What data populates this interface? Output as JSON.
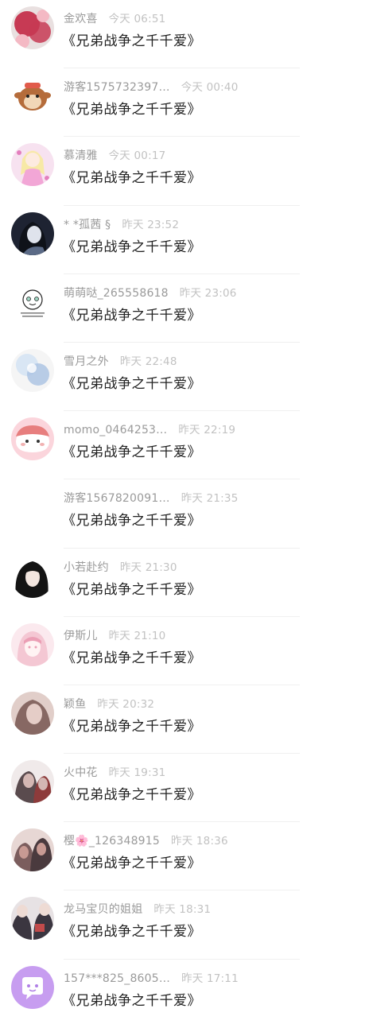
{
  "comments": [
    {
      "username": "金欢喜",
      "time": "今天 06:51",
      "content": "《兄弟战争之千千爱》",
      "avatar": "avatar-red-flowers",
      "avatar_colors": [
        "#c73a54",
        "#f4b9c4",
        "#e9e0e0"
      ]
    },
    {
      "username": "游客1575732397…",
      "time": "今天 00:40",
      "content": "《兄弟战争之千千爱》",
      "avatar": "avatar-cartoon-dog",
      "avatar_colors": [
        "#b56c3b",
        "#f2d7b8",
        "#ffffff"
      ]
    },
    {
      "username": "慕清雅",
      "time": "今天 00:17",
      "content": "《兄弟战争之千千爱》",
      "avatar": "avatar-pink-anime-girl",
      "avatar_colors": [
        "#f2a6d6",
        "#f7e2f0",
        "#e47fbe"
      ]
    },
    {
      "username": "* *孤茜 §",
      "time": "昨天 23:52",
      "content": "《兄弟战争之千千爱》",
      "avatar": "avatar-dark-anime-girl",
      "avatar_colors": [
        "#1e2332",
        "#5b6a86",
        "#dfe3ec"
      ]
    },
    {
      "username": "萌萌哒_265558618",
      "time": "昨天 23:06",
      "content": "《兄弟战争之千千爱》",
      "avatar": "avatar-doodle-face",
      "avatar_colors": [
        "#ffffff",
        "#222222",
        "#9fd6c2"
      ]
    },
    {
      "username": "雪月之外",
      "time": "昨天 22:48",
      "content": "《兄弟战争之千千爱》",
      "avatar": "avatar-blue-illustration",
      "avatar_colors": [
        "#d9e6f4",
        "#a9c2e2",
        "#f5f5f5"
      ]
    },
    {
      "username": "momo_0464253…",
      "time": "昨天 22:19",
      "content": "《兄弟战争之千千爱》",
      "avatar": "avatar-pink-blob",
      "avatar_colors": [
        "#fbd5dc",
        "#e77e7e",
        "#ffffff"
      ]
    },
    {
      "username": "游客1567820091…",
      "time": "昨天 21:35",
      "content": "《兄弟战争之千千爱》",
      "avatar": "avatar-empty",
      "avatar_colors": [
        "#ffffff",
        "#ffffff",
        "#ffffff"
      ]
    },
    {
      "username": "小若赴约",
      "time": "昨天 21:30",
      "content": "《兄弟战争之千千爱》",
      "avatar": "avatar-black-hair-girl",
      "avatar_colors": [
        "#141414",
        "#f3e6e0",
        "#ffffff"
      ]
    },
    {
      "username": "伊斯儿",
      "time": "昨天 21:10",
      "content": "《兄弟战争之千千爱》",
      "avatar": "avatar-pink-hair-anime",
      "avatar_colors": [
        "#f4c7d3",
        "#eb9fb5",
        "#fbe9ee"
      ]
    },
    {
      "username": "颖鱼",
      "time": "昨天 20:32",
      "content": "《兄弟战争之千千爱》",
      "avatar": "avatar-girl-photo",
      "avatar_colors": [
        "#bfa29a",
        "#7a5b56",
        "#eadad5"
      ]
    },
    {
      "username": "火中花",
      "time": "昨天 19:31",
      "content": "《兄弟战争之千千爱》",
      "avatar": "avatar-anime-couple",
      "avatar_colors": [
        "#5a4b4e",
        "#d4b7b3",
        "#f0eaea"
      ]
    },
    {
      "username": "樱🌸_126348915",
      "time": "昨天 18:36",
      "content": "《兄弟战争之千千爱》",
      "avatar": "avatar-anime-group",
      "avatar_colors": [
        "#7b5d5d",
        "#c89a93",
        "#e7d7d4"
      ]
    },
    {
      "username": "龙马宝贝的姐姐",
      "time": "昨天 18:31",
      "content": "《兄弟战争之千千爱》",
      "avatar": "avatar-tf-boys",
      "avatar_colors": [
        "#3b3640",
        "#e7e2e4",
        "#c24b4b"
      ]
    },
    {
      "username": "157***825_8605…",
      "time": "昨天 17:11",
      "content": "《兄弟战争之千千爱》",
      "avatar": "avatar-chat-bubble",
      "avatar_colors": [
        "#c79df0",
        "#ffffff",
        "#b07fe6"
      ]
    }
  ]
}
